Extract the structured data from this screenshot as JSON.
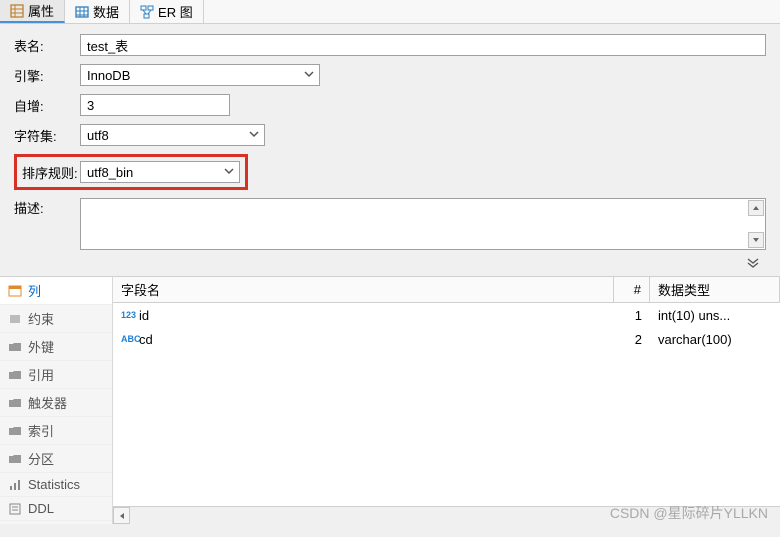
{
  "tabs": {
    "properties": "属性",
    "data": "数据",
    "er": "ER 图"
  },
  "form": {
    "table_name_label": "表名:",
    "table_name_value": "test_表",
    "engine_label": "引擎:",
    "engine_value": "InnoDB",
    "auto_inc_label": "自增:",
    "auto_inc_value": "3",
    "charset_label": "字符集:",
    "charset_value": "utf8",
    "collation_label": "排序规则:",
    "collation_value": "utf8_bin",
    "description_label": "描述:",
    "description_value": ""
  },
  "sidebar": {
    "items": [
      {
        "label": "列"
      },
      {
        "label": "约束"
      },
      {
        "label": "外键"
      },
      {
        "label": "引用"
      },
      {
        "label": "触发器"
      },
      {
        "label": "索引"
      },
      {
        "label": "分区"
      },
      {
        "label": "Statistics"
      },
      {
        "label": "DDL"
      }
    ]
  },
  "grid": {
    "headers": {
      "name": "字段名",
      "num": "#",
      "type": "数据类型"
    },
    "rows": [
      {
        "icon": "123",
        "icon_color": "#1e7fd6",
        "name": "id",
        "num": "1",
        "type": "int(10) uns..."
      },
      {
        "icon": "ABC",
        "icon_color": "#1e7fd6",
        "name": "cd",
        "num": "2",
        "type": "varchar(100)"
      }
    ]
  },
  "watermark": "CSDN @星际碎片YLLKN"
}
